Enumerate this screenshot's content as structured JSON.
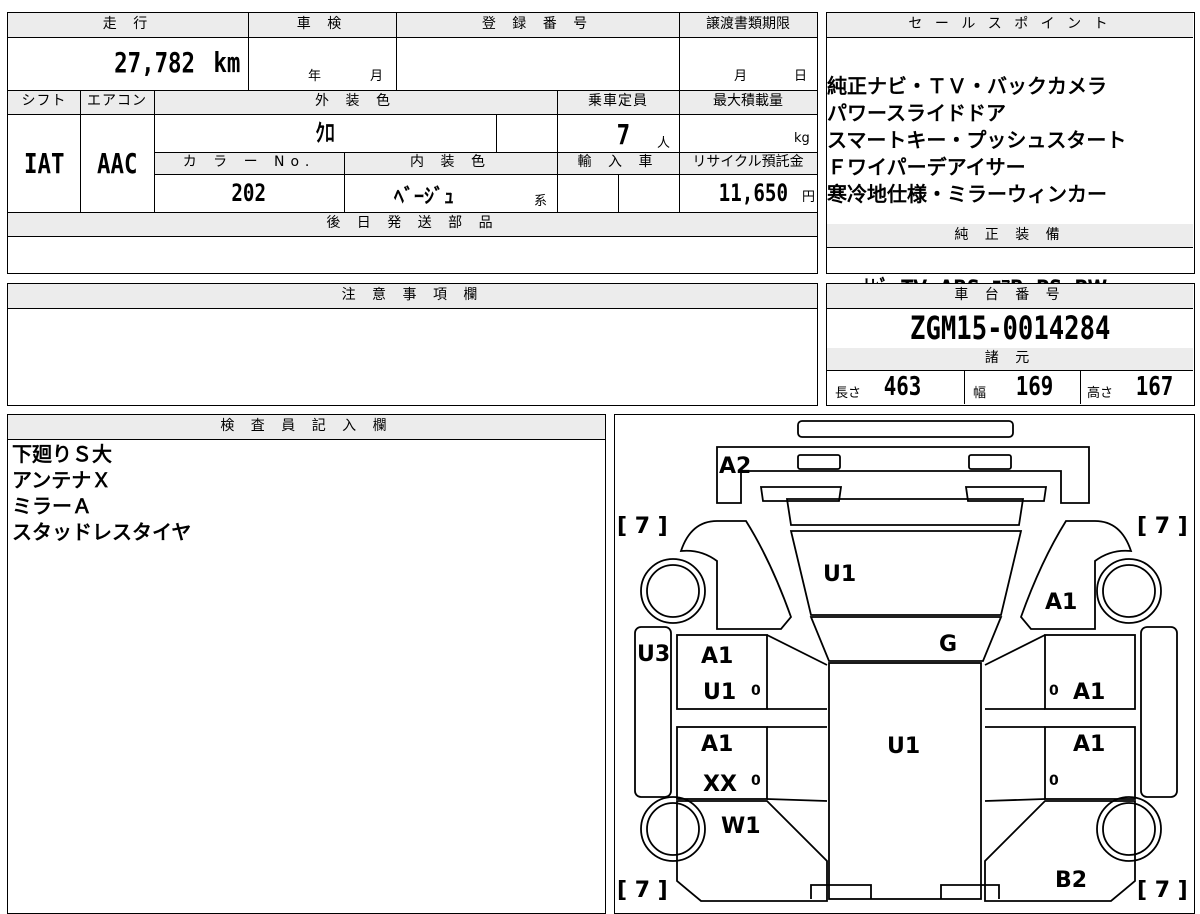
{
  "top_table": {
    "mileage_label": "走 行",
    "mileage_value": "27,782",
    "mileage_unit": "km",
    "inspection_label": "車 検",
    "inspection_year_unit": "年",
    "inspection_month_unit": "月",
    "registration_label": "登 録 番 号",
    "transfer_label": "譲渡書類期限",
    "transfer_month_unit": "月",
    "transfer_day_unit": "日",
    "shift_label": "シフト",
    "shift_value": "IAT",
    "aircon_label": "エアコン",
    "aircon_value": "AAC",
    "exterior_color_label": "外 装 色",
    "exterior_color_value": "ｸﾛ",
    "capacity_label": "乗車定員",
    "capacity_value": "7",
    "capacity_unit": "人",
    "max_load_label": "最大積載量",
    "max_load_unit": "kg",
    "color_no_label": "カ ラ ー No.",
    "color_no_value": "202",
    "interior_color_label": "内 装 色",
    "interior_color_value": "ﾍﾞｰｼﾞｭ",
    "interior_color_suffix": "系",
    "import_label": "輸 入 車",
    "recycle_label": "リサイクル預託金",
    "recycle_value": "11,650",
    "recycle_unit": "円",
    "later_parts_label": "後 日 発 送 部 品"
  },
  "sales_points": {
    "label": "セ ー ル ス ポ イ ン ト",
    "lines": [
      "純正ナビ・ＴＶ・バックカメラ",
      "パワースライドドア",
      "スマートキー・プッシュスタート",
      "Ｆワイパーデアイサー",
      "寒冷地仕様・ミラーウィンカー"
    ]
  },
  "equipment": {
    "label": "純 正 装 備",
    "value": "ﾅﾋﾞ  TV  ABS  ｴｱB  PS  PW"
  },
  "notes": {
    "label": "注 意 事 項 欄"
  },
  "chassis": {
    "label": "車 台 番 号",
    "value": "ZGM15-0014284"
  },
  "specs": {
    "label": "諸 元",
    "length_label": "長さ",
    "length_value": "463",
    "width_label": "幅",
    "width_value": "169",
    "height_label": "高さ",
    "height_value": "167"
  },
  "inspector": {
    "label": "検 査 員 記 入 欄",
    "lines": [
      "下廻りＳ大",
      "アンテナＸ",
      "ミラーＡ",
      "スタッドレスタイヤ"
    ]
  },
  "diagram": {
    "tread_marks": [
      "[ 7 ]",
      "[ 7 ]",
      "[ 7 ]",
      "[ 7 ]"
    ],
    "damage_codes": [
      {
        "code": "A2"
      },
      {
        "code": "U1"
      },
      {
        "code": "A1"
      },
      {
        "code": "G"
      },
      {
        "code": "U3"
      },
      {
        "code": "A1"
      },
      {
        "code": "U1"
      },
      {
        "code": "A1"
      },
      {
        "code": "A1"
      },
      {
        "code": "U1"
      },
      {
        "code": "A1"
      },
      {
        "code": "XX"
      },
      {
        "code": "W1"
      },
      {
        "code": "B2"
      }
    ],
    "zero_marks": [
      "0",
      "0",
      "0",
      "0"
    ]
  }
}
